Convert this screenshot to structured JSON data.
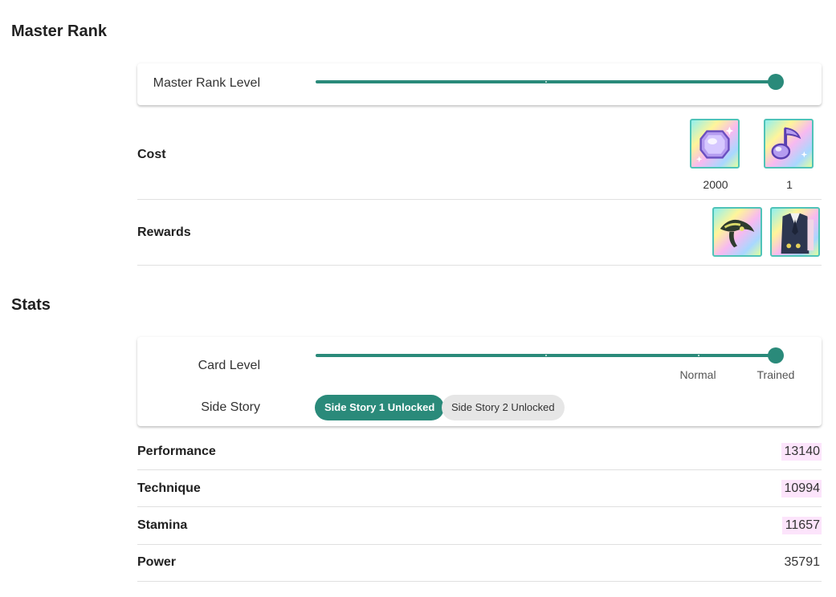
{
  "master_rank": {
    "title": "Master Rank",
    "level_label": "Master Rank Level",
    "level_fraction": 1.0,
    "cost_label": "Cost",
    "cost_items": [
      {
        "icon": "octagon-gem-icon",
        "qty": "2000"
      },
      {
        "icon": "music-note-gem-icon",
        "qty": "1"
      }
    ],
    "rewards_label": "Rewards",
    "reward_items": [
      {
        "icon": "hair-accessory-icon"
      },
      {
        "icon": "costume-icon"
      }
    ]
  },
  "stats": {
    "title": "Stats",
    "card_level_label": "Card Level",
    "card_level_fraction": 1.0,
    "card_level_marks": [
      "Normal",
      "Trained"
    ],
    "side_story_label": "Side Story",
    "side_story_chips": [
      {
        "label": "Side Story 1 Unlocked",
        "active": true
      },
      {
        "label": "Side Story 2 Unlocked",
        "active": false
      }
    ],
    "rows": [
      {
        "label": "Performance",
        "value": "13140",
        "highlight": true
      },
      {
        "label": "Technique",
        "value": "10994",
        "highlight": true
      },
      {
        "label": "Stamina",
        "value": "11657",
        "highlight": true
      },
      {
        "label": "Power",
        "value": "35791",
        "highlight": false
      }
    ]
  },
  "colors": {
    "accent": "#2a8a7a",
    "highlight": "#fce4fb",
    "item_border": "#4fc3b8"
  }
}
